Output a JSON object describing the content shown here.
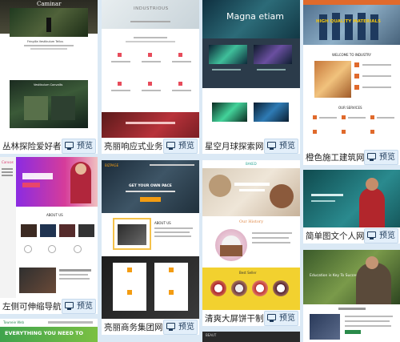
{
  "preview_label": "预览",
  "templates": [
    {
      "title": "丛林探险爱好者网站模",
      "hero_text": "Caminar",
      "hero_sub": "Fringilla Vestibulum Tellus",
      "section": "Vestibulum Convallis"
    },
    {
      "title": "亮丽响应式业务网站模",
      "hero_text": "INDUSTRIOUS"
    },
    {
      "title": "星空月球探索网站模板",
      "hero_text": "Magna etiam"
    },
    {
      "title": "橙色施工建筑网站模板",
      "hero_text": "HIGH QUALITY MATERIALS",
      "welcome": "WELCOME TO INDUSTRY",
      "services": "OUR SERVICES"
    },
    {
      "title": "左侧可伸缩导航企业网",
      "logo": "Canvas",
      "about": "ABOUT US"
    },
    {
      "title": "亮丽商务集团网站模板",
      "logo": "BIZPAGE",
      "hero_text": "GET YOUR OWN PACE",
      "about": "ABOUT US"
    },
    {
      "title": "清爽大屏饼干制作网站",
      "logo": "BAKED",
      "history": "Our History",
      "best": "Best Seller"
    },
    {
      "title": "简单图文个人网站模板"
    },
    {
      "title": "",
      "hero_text": "EVERYTHING YOU NEED TO"
    },
    {
      "title": "",
      "hero_text": "Education is Key To Success"
    }
  ],
  "colors": {
    "page_bg": "#dbe9f5",
    "accent_orange": "#f39c12",
    "pink": "#e8456b",
    "yellow": "#f2d12f"
  }
}
